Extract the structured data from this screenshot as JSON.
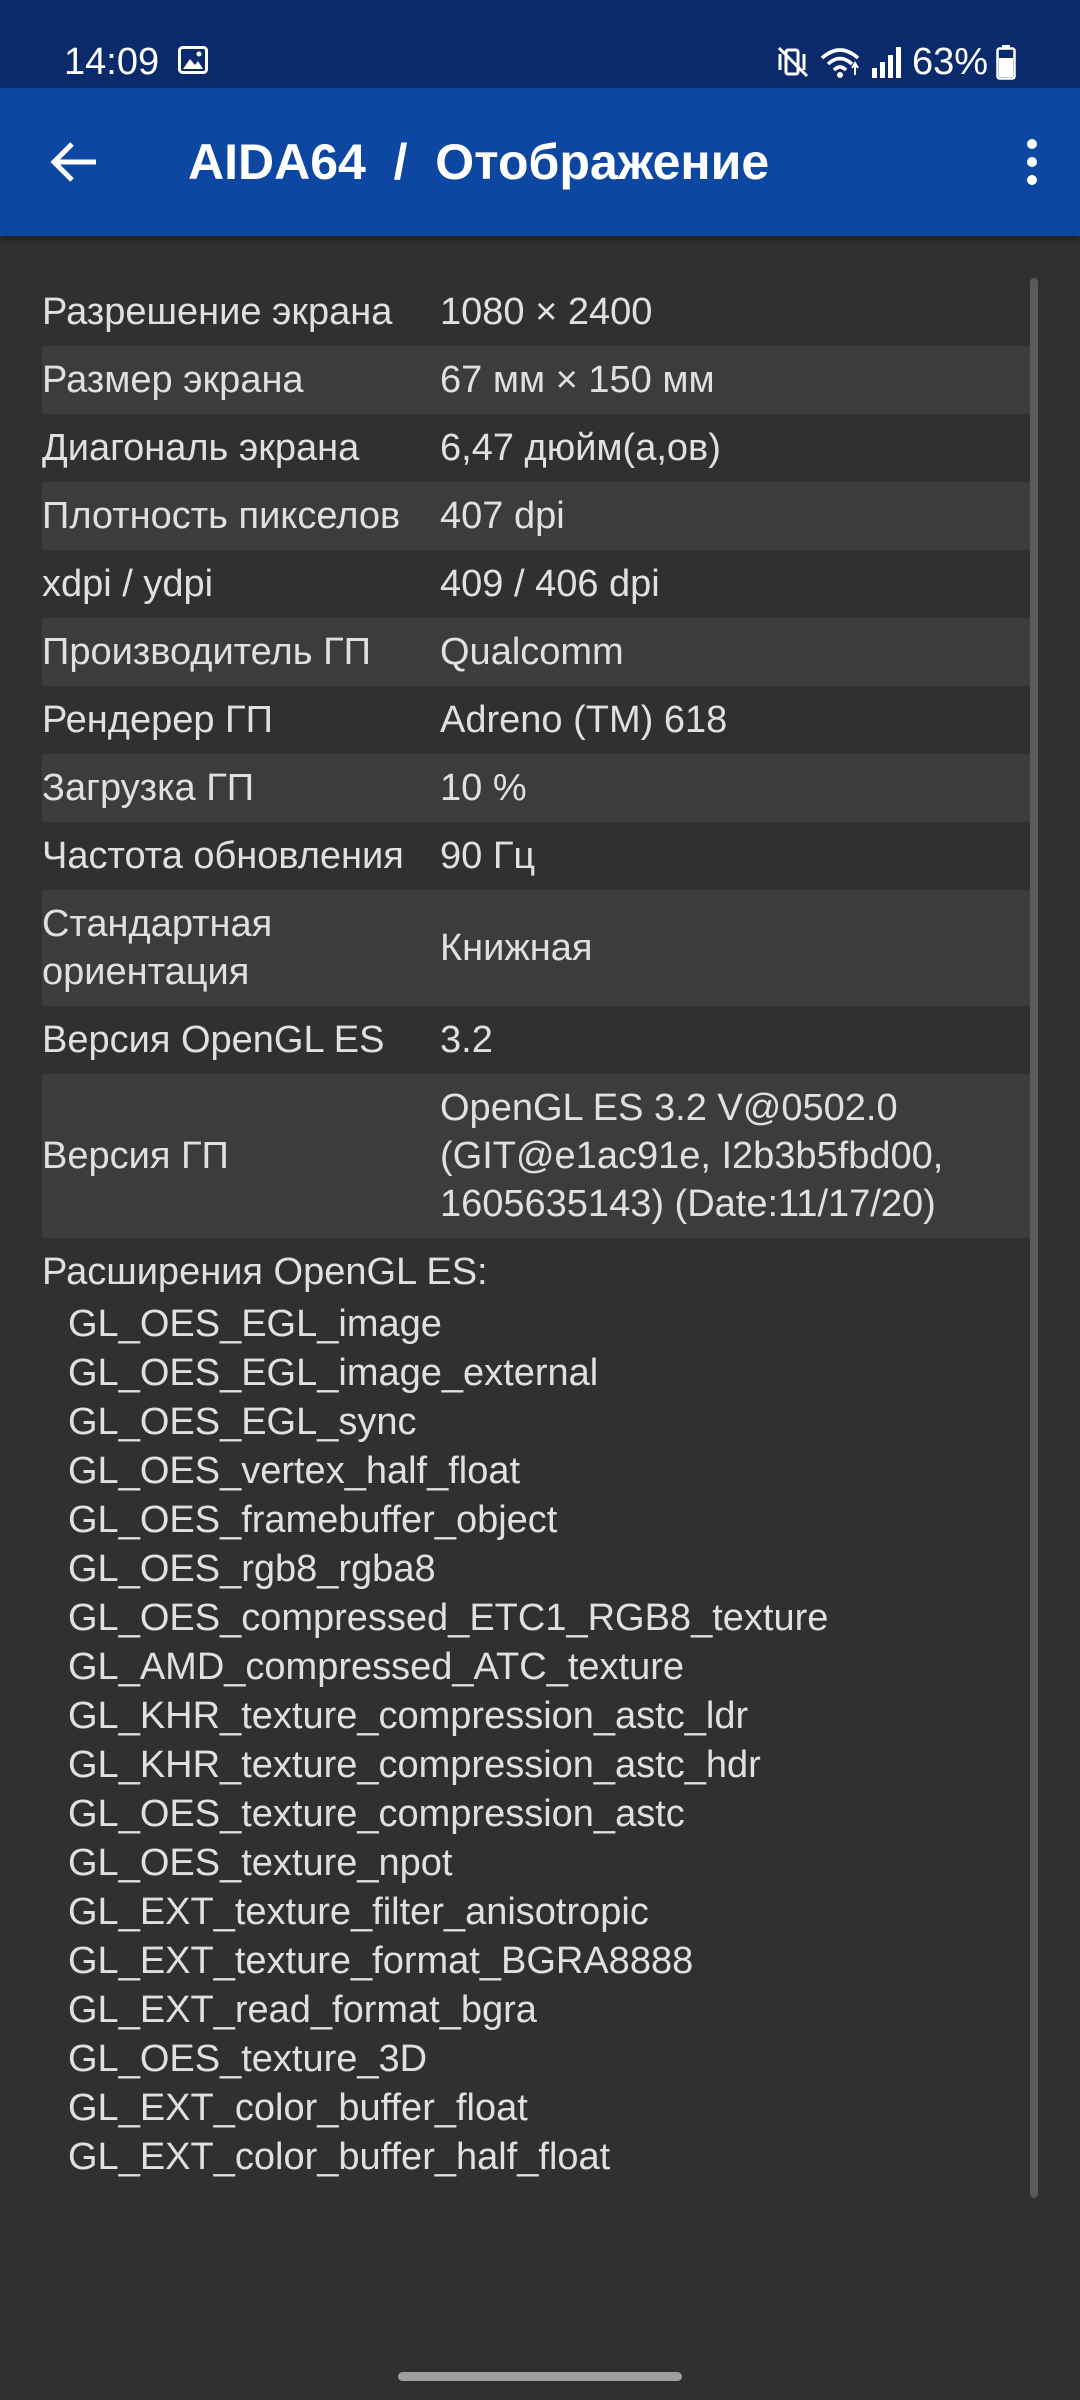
{
  "status_bar": {
    "time": "14:09",
    "battery": "63%",
    "icons": [
      "image-icon",
      "mute-vibrate-icon",
      "wifi-icon",
      "signal-icon",
      "battery-icon"
    ]
  },
  "app_bar": {
    "title": "AIDA64  /  Отображение",
    "back_icon": "arrow-back-icon",
    "menu_icon": "more-vert-icon",
    "color": "#0D47A1"
  },
  "rows": [
    {
      "label": "Разрешение экрана",
      "value": "1080 × 2400"
    },
    {
      "label": "Размер экрана",
      "value": "67 мм × 150 мм"
    },
    {
      "label": "Диагональ экрана",
      "value": "6,47 дюйм(а,ов)"
    },
    {
      "label": "Плотность пикселов",
      "value": "407 dpi"
    },
    {
      "label": "xdpi / ydpi",
      "value": "409 / 406 dpi"
    },
    {
      "label": "Производитель ГП",
      "value": "Qualcomm"
    },
    {
      "label": "Рендерер ГП",
      "value": "Adreno (TM) 618"
    },
    {
      "label": "Загрузка ГП",
      "value": "10 %"
    },
    {
      "label": "Частота обновления",
      "value": "90 Гц"
    },
    {
      "label": "Стандартная ориентация",
      "value": "Книжная"
    },
    {
      "label": "Версия OpenGL ES",
      "value": "3.2"
    },
    {
      "label": "Версия ГП",
      "value": "OpenGL ES 3.2 V@0502.0\n(GIT@e1ac91e, I2b3b5fbd00,\n1605635143) (Date:11/17/20)"
    }
  ],
  "extensions": {
    "heading": "Расширения OpenGL ES:",
    "items": [
      "GL_OES_EGL_image",
      "GL_OES_EGL_image_external",
      "GL_OES_EGL_sync",
      "GL_OES_vertex_half_float",
      "GL_OES_framebuffer_object",
      "GL_OES_rgb8_rgba8",
      "GL_OES_compressed_ETC1_RGB8_texture",
      "GL_AMD_compressed_ATC_texture",
      "GL_KHR_texture_compression_astc_ldr",
      "GL_KHR_texture_compression_astc_hdr",
      "GL_OES_texture_compression_astc",
      "GL_OES_texture_npot",
      "GL_EXT_texture_filter_anisotropic",
      "GL_EXT_texture_format_BGRA8888",
      "GL_EXT_read_format_bgra",
      "GL_OES_texture_3D",
      "GL_EXT_color_buffer_float",
      "GL_EXT_color_buffer_half_float"
    ]
  }
}
